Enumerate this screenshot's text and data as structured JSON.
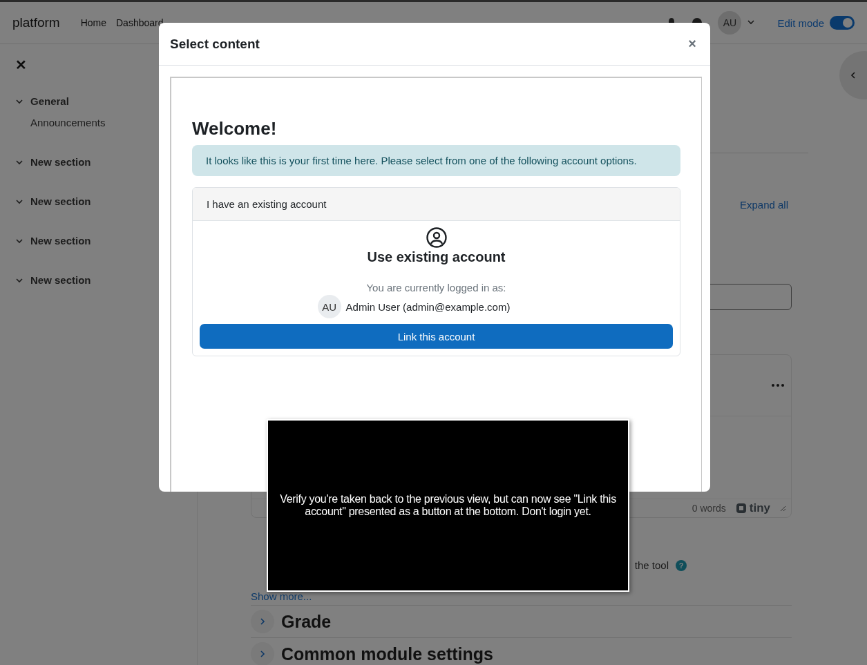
{
  "navbar": {
    "brand": "platform",
    "links": [
      "Home",
      "Dashboard"
    ],
    "avatar": "AU",
    "edit_mode": {
      "label": "Edit mode",
      "on": true
    }
  },
  "sidebar": {
    "close_icon": "✕",
    "sections": [
      {
        "title": "General",
        "expanded": true,
        "children": [
          "Announcements"
        ]
      },
      {
        "title": "New section",
        "expanded": true
      },
      {
        "title": "New section",
        "expanded": true
      },
      {
        "title": "New section",
        "expanded": true
      },
      {
        "title": "New section",
        "expanded": true
      }
    ]
  },
  "main": {
    "expand_all": "Expand all",
    "editor": {
      "word_count": "0 words",
      "brand": "tiny"
    },
    "help_text": "the tool",
    "help_icon": "?",
    "show_more": "Show more...",
    "sections": [
      {
        "title": "Grade",
        "expanded": false
      },
      {
        "title": "Common module settings",
        "expanded": false
      }
    ]
  },
  "modal": {
    "title": "Select content",
    "close_icon": "×",
    "heading": "Welcome!",
    "alert": "It looks like this is your first time here. Please select from one of the following account options.",
    "card": {
      "header": "I have an existing account",
      "title": "Use existing account",
      "logged_in_label": "You are currently logged in as:",
      "avatar": "AU",
      "user": "Admin User (admin@example.com)",
      "button": "Link this account"
    }
  },
  "caption": {
    "text": "Verify you're taken back to the previous view, but can now see \"Link this account\" presented as a button at the bottom. Don't login yet."
  }
}
